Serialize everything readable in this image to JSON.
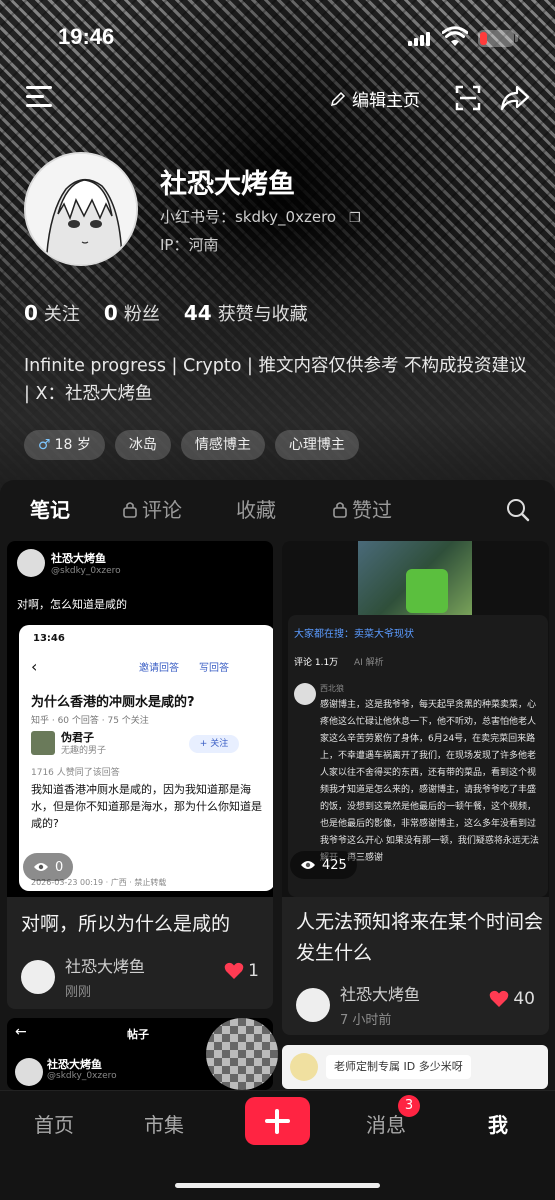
{
  "status_bar": {
    "time": "19:46"
  },
  "topbar": {
    "edit_label": "编辑主页"
  },
  "profile": {
    "name": "社恐大烤鱼",
    "red_id": "小红书号：skdky_0xzero",
    "ip": "IP：河南"
  },
  "stats": [
    {
      "value": "0",
      "label": "关注"
    },
    {
      "value": "0",
      "label": "粉丝"
    },
    {
      "value": "44",
      "label": "获赞与收藏"
    }
  ],
  "bio": "Infinite progress | Crypto | 推文内容仅供参考 不构成投资建议 | X：社恐大烤鱼",
  "tags": [
    "18 岁",
    "冰岛",
    "情感博主",
    "心理博主"
  ],
  "tabs": [
    {
      "label": "笔记",
      "active": true,
      "locked": false
    },
    {
      "label": "评论",
      "active": false,
      "locked": true
    },
    {
      "label": "收藏",
      "active": false,
      "locked": false
    },
    {
      "label": "赞过",
      "active": false,
      "locked": true
    }
  ],
  "posts": [
    {
      "title": "对啊，所以为什么是咸的",
      "views": "0",
      "author": "社恐大烤鱼",
      "time": "刚刚",
      "likes": "1",
      "screenshot": {
        "tweet_name": "社恐大烤鱼",
        "tweet_handle": "@skdky_0xzero",
        "tweet_text": "对啊，怎么知道是咸的",
        "inner_time": "13:46",
        "invite": "邀请回答",
        "write": "写回答",
        "question": "为什么香港的冲厕水是咸的?",
        "question_meta": "知乎 · 60 个回答 · 75 个关注",
        "answerer": "伪君子",
        "answerer_sub": "无趣的男子",
        "follow": "+ 关注",
        "agree": "1716 人赞同了该回答",
        "answer": "我知道香港冲厕水是咸的，因为我知道那是海水，但是你不知道那是海水，那为什么你知道是咸的?",
        "footer": "2026-03-23 00:19 · 广西 · 禁止转载"
      }
    },
    {
      "title": "人无法预知将来在某个时间会发生什么",
      "views": "425",
      "author": "社恐大烤鱼",
      "time": "7 小时前",
      "likes": "40",
      "screenshot": {
        "search_prefix": "大家都在搜：",
        "search_term": "卖菜大爷现状",
        "comments_count": "评论 1.1万",
        "ai": "AI 解析",
        "commenter": "西北狼",
        "comment": "感谢博主，这是我爷爷，每天起早贪黑的种菜卖菜，心疼他这么忙碌让他休息一下，他不听劝，总害怕他老人家这么辛苦劳累伤了身体，6月24号，在卖完菜回来路上，不幸遭遇车祸离开了我们，在现场发现了许多他老人家以往不舍得买的东西，还有带的菜品，看到这个视频我才知道是怎么来的，感谢博主，请我爷爷吃了丰盛的饭，没想到这竟然是他最后的一顿午餐，这个视频，也是他最后的影像，非常感谢博主，这么多年没看到过我爷爷这么开心 如果没有那一顿，我们疑惑将永远无法解开，再三感谢"
      }
    }
  ],
  "card3": {
    "header": "帖子",
    "name": "社恐大烤鱼",
    "handle": "@skdky_0xzero"
  },
  "pinned": {
    "label": "老师定制专属 ID 多少米呀"
  },
  "bottom_nav": [
    {
      "label": "首页",
      "active": false
    },
    {
      "label": "市集",
      "active": false
    },
    {
      "label": "消息",
      "active": false
    },
    {
      "label": "我",
      "active": true
    }
  ],
  "message_badge": "3",
  "colors": {
    "accent": "#ff2442",
    "panel": "#161616",
    "card": "#222222"
  }
}
